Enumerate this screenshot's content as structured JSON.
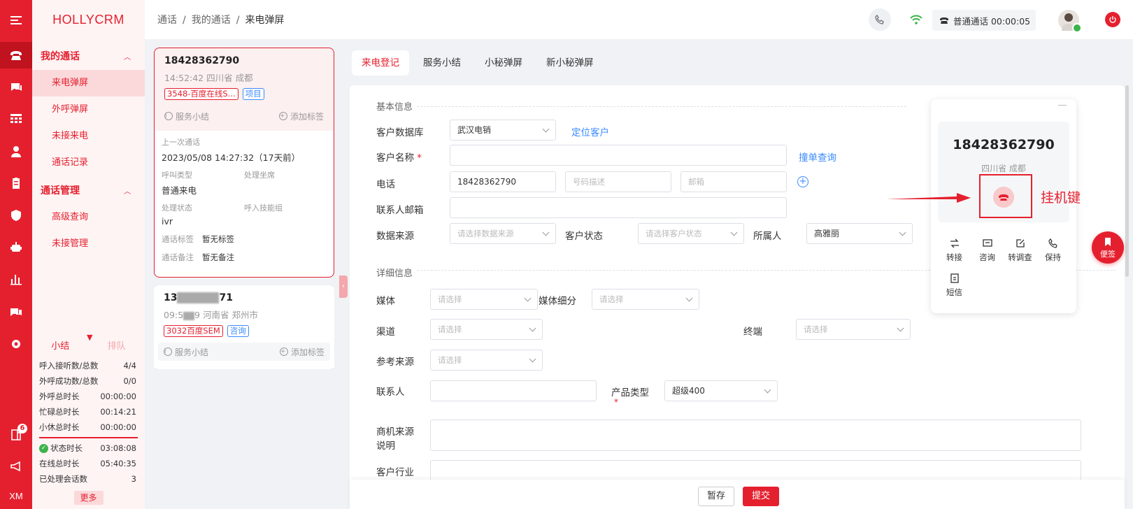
{
  "nav": {
    "logo": "HOLLYCRM",
    "group1": "我的通话",
    "group1_items": [
      "来电弹屏",
      "外呼弹屏",
      "未接来电",
      "通话记录"
    ],
    "group2": "通话管理",
    "group2_items": [
      "高级查询",
      "未接管理"
    ],
    "rail_bottom_label": "XM",
    "rail_badge": "6"
  },
  "stats": {
    "tab1": "小结",
    "tab2": "排队",
    "rows": [
      {
        "k": "呼入接听数/总数",
        "v": "4/4"
      },
      {
        "k": "外呼成功数/总数",
        "v": "0/0"
      },
      {
        "k": "外呼总时长",
        "v": "00:00:00"
      },
      {
        "k": "忙碌总时长",
        "v": "00:14:21"
      },
      {
        "k": "小休总时长",
        "v": "00:00:00"
      }
    ],
    "rows2": [
      {
        "k": "状态时长",
        "v": "03:08:08"
      },
      {
        "k": "在线总时长",
        "v": "05:40:35"
      },
      {
        "k": "已处理会话数",
        "v": "3"
      }
    ],
    "more": "更多"
  },
  "topbar": {
    "breadcrumb": [
      "通话",
      "我的通话",
      "来电弹屏"
    ],
    "call_status": "普通通话 00:00:05"
  },
  "calls": {
    "c1": {
      "number": "18428362790",
      "sub": "14:52:42 四川省 成都",
      "tag1": "3548-百度在线S...",
      "tag2": "项目",
      "summary": "服务小结",
      "addtag": "添加标签",
      "last_label": "上一次通话",
      "last_value": "2023/05/08 14:27:32（17天前）",
      "type_label": "呼叫类型",
      "type_value": "普通来电",
      "agent_label": "处理坐席",
      "status_label": "处理状态",
      "status_value": "ivr",
      "skill_label": "呼入技能组",
      "tag_label": "通话标签",
      "tag_value": "暂无标签",
      "remark_label": "通话备注",
      "remark_value": "暂无备注"
    },
    "c2": {
      "number_prefix": "13",
      "number_suffix": "71",
      "sub_prefix": "09:5",
      "sub_suffix": "9 河南省 郑州市",
      "tag1": "3032百度SEM",
      "tag2": "咨询",
      "summary": "服务小结",
      "addtag": "添加标签"
    }
  },
  "tabs": [
    "来电登记",
    "服务小结",
    "小秘弹屏",
    "新小秘弹屏"
  ],
  "form": {
    "section_basic": "基本信息",
    "section_detail": "详细信息",
    "db_label": "客户数据库",
    "db_value": "武汉电销",
    "locate_link": "定位客户",
    "name_label": "客户名称",
    "name_req": "*",
    "dup_link": "撞单查询",
    "phone_label": "电话",
    "phone_value": "18428362790",
    "phone_desc_ph": "号码描述",
    "email_ph": "邮箱",
    "contact_email_label": "联系人邮箱",
    "source_label": "数据来源",
    "source_ph": "请选择数据来源",
    "cust_status_label": "客户状态",
    "cust_status_ph": "请选择客户状态",
    "owner_label": "所属人",
    "owner_value": "高雅丽",
    "media_label": "媒体",
    "media_ph": "请选择",
    "media_sub_label": "媒体细分",
    "media_sub_ph": "请选择",
    "channel_label": "渠道",
    "channel_ph": "请选择",
    "terminal_label": "终端",
    "terminal_ph": "请选择",
    "ref_label": "参考来源",
    "ref_ph": "请选择",
    "contact_label": "联系人",
    "product_label": "产品类型",
    "product_value": "超级400",
    "opp_label_1": "商机来源",
    "opp_label_2": "说明",
    "industry_label": "客户行业",
    "save_btn": "暂存",
    "submit_btn": "提交"
  },
  "widget": {
    "number": "18428362790",
    "location": "四川省 成都",
    "buttons": [
      "转接",
      "咨询",
      "转调查",
      "保持",
      "短信"
    ],
    "annotation": "挂机键",
    "memo": "便签"
  },
  "colors": {
    "brand": "#e5202e",
    "link": "#3c8bff",
    "ok": "#3bb34a"
  }
}
